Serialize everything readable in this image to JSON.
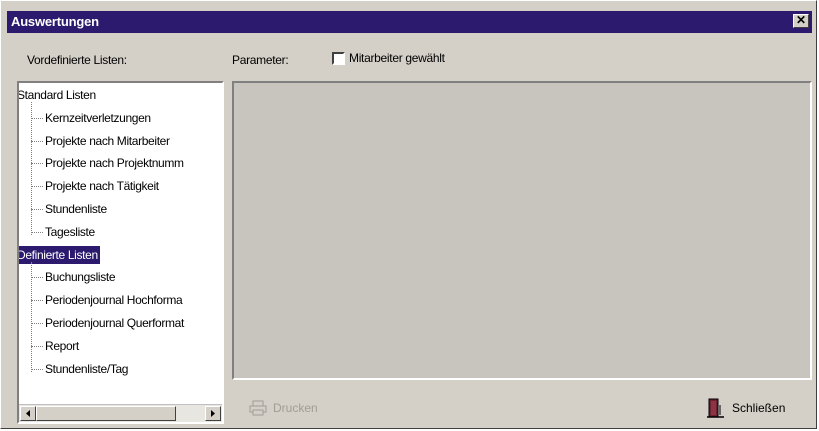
{
  "window": {
    "title": "Auswertungen",
    "close_symbol": "✕"
  },
  "labels": {
    "predefined_lists": "Vordefinierte Listen:",
    "parameters": "Parameter:",
    "checkbox_label": "Mitarbeiter gewählt"
  },
  "checkbox": {
    "checked": false
  },
  "tree": {
    "groups": [
      {
        "label": "Standard Listen",
        "items": [
          "Kernzeitverletzungen",
          "Projekte nach Mitarbeiter",
          "Projekte nach Projektnumm",
          "Projekte nach Tätigkeit",
          "Stundenliste",
          "Tagesliste"
        ]
      },
      {
        "label": "Definierte Listen",
        "selected": true,
        "items": [
          "Buchungsliste",
          "Periodenjournal Hochforma",
          "Periodenjournal Querformat",
          "Report",
          "Stundenliste/Tag"
        ]
      }
    ]
  },
  "buttons": {
    "print": {
      "label": "Drucken",
      "enabled": false,
      "icon": "printer-icon"
    },
    "close": {
      "label": "Schließen",
      "icon": "door-exit-icon"
    }
  },
  "colors": {
    "titlebar": "#2b1a6e",
    "selection": "#2b1a6e",
    "face": "#d4d0c8"
  }
}
